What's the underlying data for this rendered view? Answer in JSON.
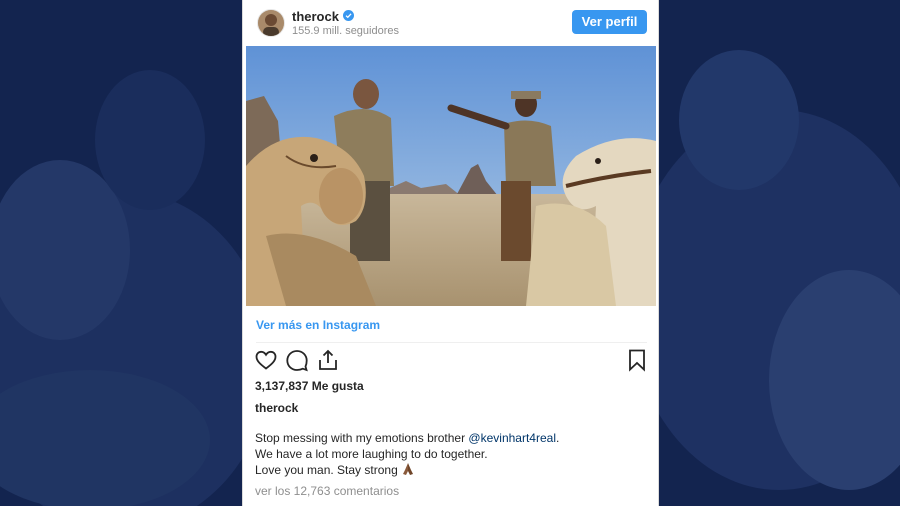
{
  "post": {
    "username": "therock",
    "followers": "155.9 mill. seguidores",
    "view_profile_label": "Ver perfil",
    "view_more_label": "Ver más en Instagram",
    "likes": "3,137,837 Me gusta",
    "caption_username": "therock",
    "caption_line1_pre": "Stop messing with my emotions brother ",
    "caption_mention": "@kevinhart4real",
    "caption_line1_post": ".",
    "caption_line2": "We have a lot more laughing to do together.",
    "caption_line3": "Love you man. Stay strong",
    "comments_link": "ver los 12,763 comentarios"
  },
  "icons": {
    "verified": "verified-badge-icon",
    "like": "heart-icon",
    "comment": "comment-bubble-icon",
    "share": "share-icon",
    "save": "bookmark-icon",
    "emoji": "praying-hands-icon"
  },
  "colors": {
    "accent": "#3897f0",
    "background": "#14234a",
    "text": "#262626",
    "muted": "#8e8e8e"
  }
}
